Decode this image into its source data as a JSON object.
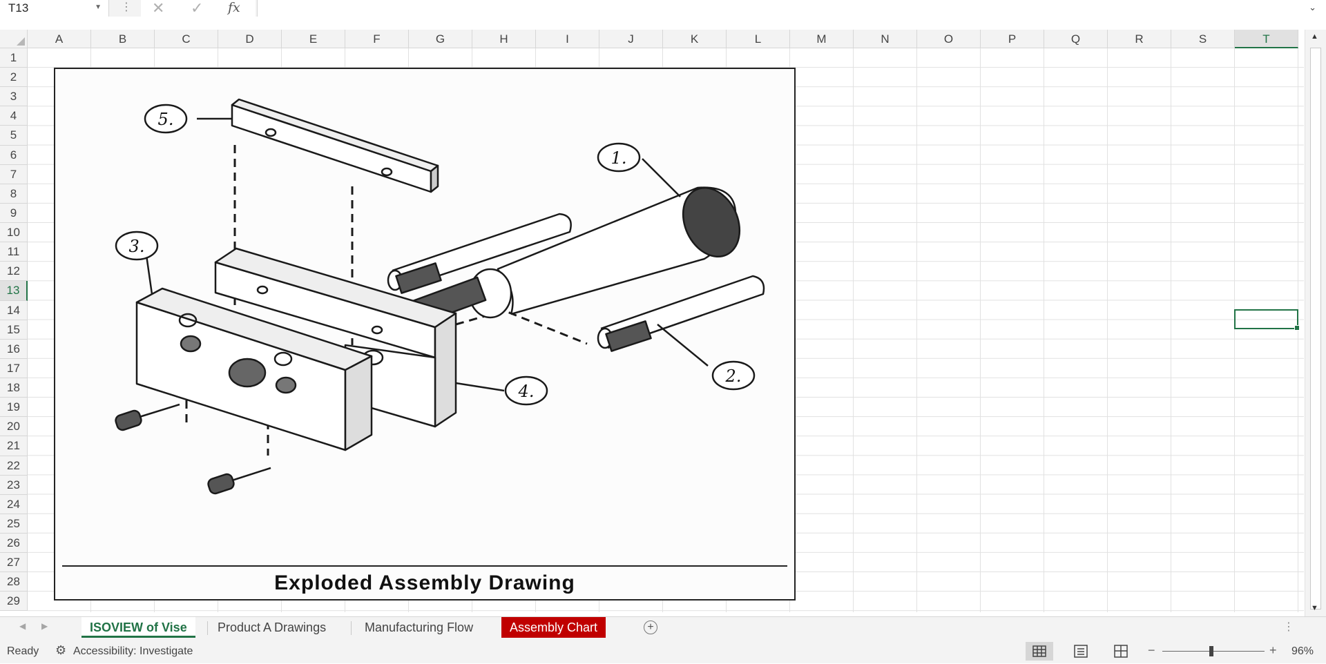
{
  "formula_bar": {
    "name_box": "T13",
    "formula": "",
    "fx_label": "fx"
  },
  "columns": [
    "A",
    "B",
    "C",
    "D",
    "E",
    "F",
    "G",
    "H",
    "I",
    "J",
    "K",
    "L",
    "M",
    "N",
    "O",
    "P",
    "Q",
    "R",
    "S",
    "T"
  ],
  "rows": [
    "1",
    "2",
    "3",
    "4",
    "5",
    "6",
    "7",
    "8",
    "9",
    "10",
    "11",
    "12",
    "13",
    "14",
    "15",
    "16",
    "17",
    "18",
    "19",
    "20",
    "21",
    "22",
    "23",
    "24",
    "25",
    "26",
    "27",
    "28",
    "29"
  ],
  "selected": {
    "column": "T",
    "row": "13"
  },
  "drawing": {
    "caption": "Exploded Assembly Drawing",
    "callouts": [
      "1.",
      "2.",
      "3.",
      "4.",
      "5."
    ]
  },
  "sheet_tabs": [
    {
      "label": "ISOVIEW of Vise",
      "state": "active"
    },
    {
      "label": "Product A Drawings",
      "state": "normal"
    },
    {
      "label": "Manufacturing Flow",
      "state": "normal"
    },
    {
      "label": "Assembly Chart",
      "state": "red"
    }
  ],
  "status": {
    "ready": "Ready",
    "accessibility": "Accessibility: Investigate",
    "zoom": "96%"
  },
  "colors": {
    "accent": "#217346",
    "red_tab": "#c00000",
    "grid_line": "#e1e1e1"
  }
}
